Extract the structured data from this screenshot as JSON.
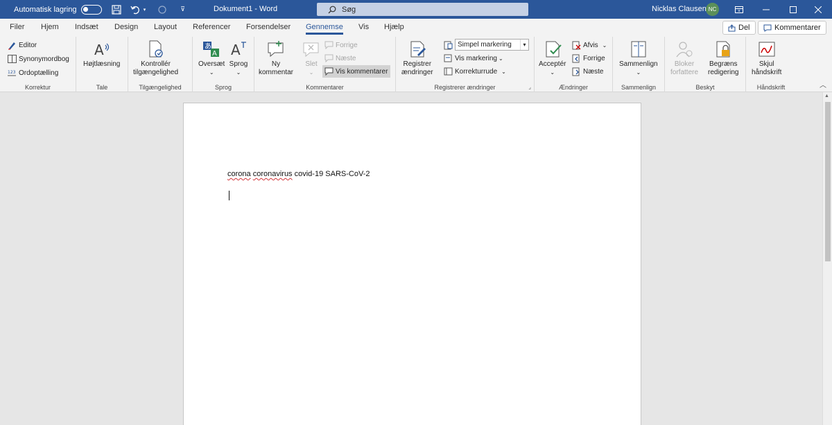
{
  "titlebar": {
    "autosave_label": "Automatisk lagring",
    "document_title": "Dokument1  -  Word",
    "search_placeholder": "Søg",
    "user_name": "Nicklas Clausen",
    "user_initials": "NC"
  },
  "tabs": [
    "Filer",
    "Hjem",
    "Indsæt",
    "Design",
    "Layout",
    "Referencer",
    "Forsendelser",
    "Gennemse",
    "Vis",
    "Hjælp"
  ],
  "active_tab": "Gennemse",
  "share": {
    "del_label": "Del",
    "comments_label": "Kommentarer"
  },
  "ribbon": {
    "korrektur": {
      "label": "Korrektur",
      "editor": "Editor",
      "synonym": "Synonymordbog",
      "wordcount": "Ordoptælling"
    },
    "tale": {
      "label": "Tale",
      "read_aloud": "Højtlæsning"
    },
    "access": {
      "label": "Tilgængelighed",
      "line1": "Kontrollér",
      "line2": "tilgængelighed"
    },
    "sprog": {
      "label": "Sprog",
      "translate": "Oversæt",
      "language": "Sprog"
    },
    "kommentarer": {
      "label": "Kommentarer",
      "new_line1": "Ny",
      "new_line2": "kommentar",
      "delete": "Slet",
      "previous": "Forrige",
      "next": "Næste",
      "show": "Vis kommentarer"
    },
    "track": {
      "label": "Registrerer ændringer",
      "reg_line1": "Registrer",
      "reg_line2": "ændringer",
      "markup_select": "Simpel markering",
      "show_markup": "Vis markering",
      "review_pane": "Korrekturrude"
    },
    "changes": {
      "label": "Ændringer",
      "accept": "Acceptér",
      "reject": "Afvis",
      "previous": "Forrige",
      "next": "Næste"
    },
    "compare": {
      "label": "Sammenlign",
      "compare": "Sammenlign"
    },
    "protect": {
      "label": "Beskyt",
      "block_line1": "Bloker",
      "block_line2": "forfattere",
      "restrict_line1": "Begræns",
      "restrict_line2": "redigering"
    },
    "ink": {
      "label": "Håndskrift",
      "hide_line1": "Skjul",
      "hide_line2": "håndskrift"
    }
  },
  "document": {
    "words": [
      "corona",
      "coronavirus",
      "covid-19",
      "SARS-CoV-2"
    ]
  },
  "colors": {
    "accent": "#2b579a",
    "spell_error": "#d13438"
  }
}
